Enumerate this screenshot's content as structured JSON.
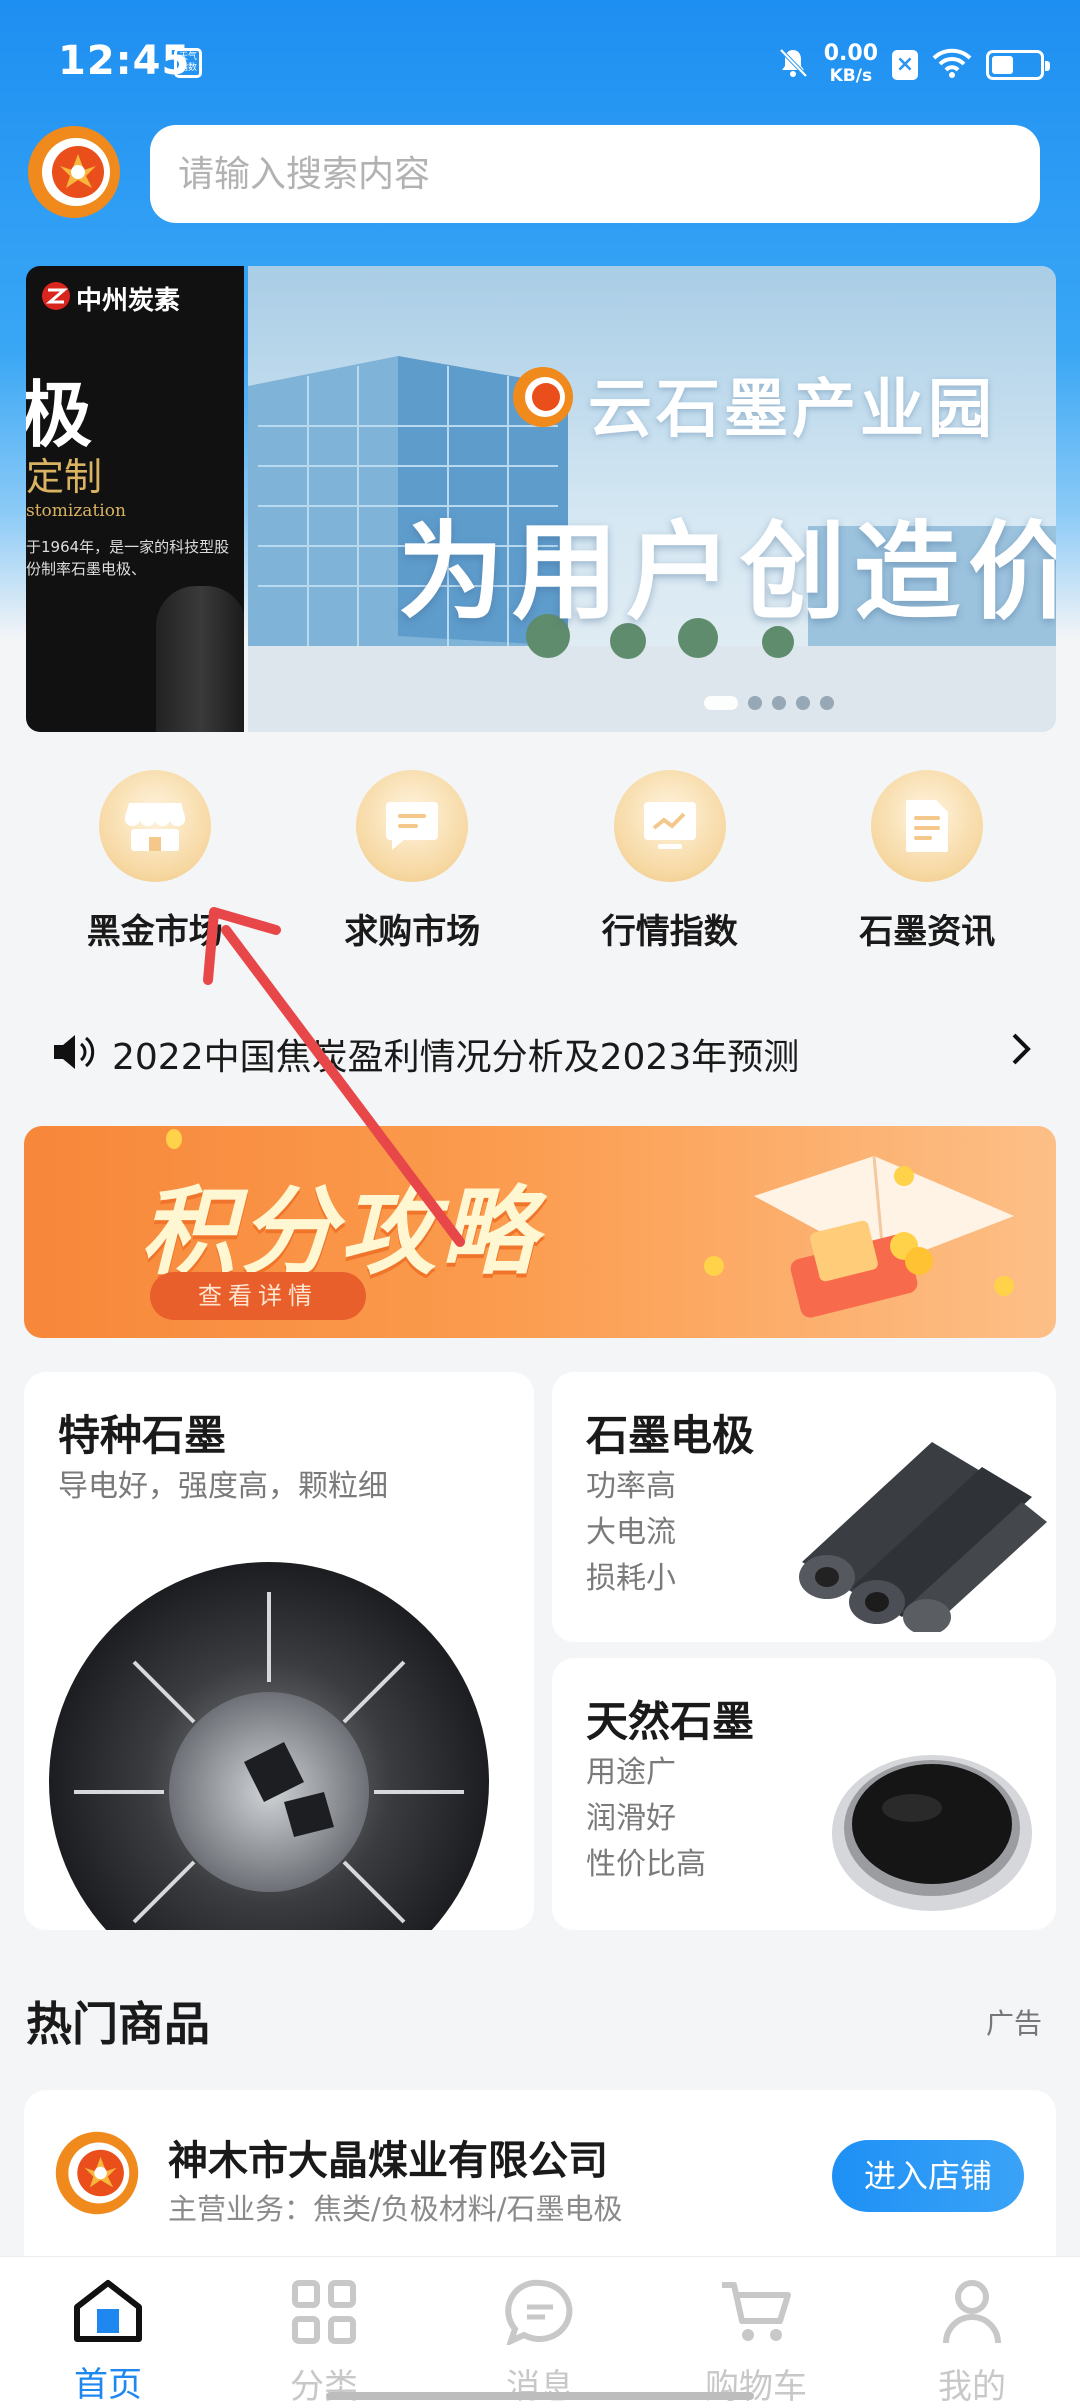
{
  "status_bar": {
    "time": "12:45",
    "weather_badge": "天气 指数",
    "net_speed_value": "0.00",
    "net_speed_unit": "KB/s",
    "battery_level": 0.45,
    "icons": [
      "mute-bell-icon",
      "x-badge-icon",
      "wifi-icon",
      "battery-icon"
    ]
  },
  "header": {
    "logo_icon": "company-logo-icon",
    "search_placeholder": "请输入搜索内容"
  },
  "banner": {
    "left_slide": {
      "brand": "中州炭素",
      "big_text": "极",
      "gold_text": "定制",
      "en_text": "stomization",
      "desc": "于1964年，是一家的科技型股份制率石墨电极、"
    },
    "main_slide": {
      "park_name": "云石墨产业园",
      "slogan": "为用户创造价值"
    },
    "dot_count": 5,
    "active_dot": 0
  },
  "quick_nav": [
    {
      "label": "黑金市场",
      "icon": "store-icon"
    },
    {
      "label": "求购市场",
      "icon": "message-icon"
    },
    {
      "label": "行情指数",
      "icon": "chart-monitor-icon"
    },
    {
      "label": "石墨资讯",
      "icon": "document-icon"
    }
  ],
  "notice": {
    "icon": "speaker-icon",
    "text": "2022中国焦炭盈利情况分析及2023年预测"
  },
  "promo": {
    "title": "积分攻略",
    "button": "查看详情"
  },
  "product_cards": {
    "special": {
      "title": "特种石墨",
      "desc": "导电好，强度高，颗粒细"
    },
    "electrode": {
      "title": "石墨电极",
      "lines": [
        "功率高",
        "大电流",
        "损耗小"
      ]
    },
    "natural": {
      "title": "天然石墨",
      "lines": [
        "用途广",
        "润滑好",
        "性价比高"
      ]
    }
  },
  "hot_products": {
    "title": "热门商品",
    "ad_label": "广告",
    "shop": {
      "name": "神木市大晶煤业有限公司",
      "business": "主营业务：焦类/负极材料/石墨电极",
      "enter_button": "进入店铺"
    }
  },
  "tab_bar": [
    {
      "label": "首页",
      "icon": "home-icon",
      "active": true
    },
    {
      "label": "分类",
      "icon": "grid-icon",
      "active": false
    },
    {
      "label": "消息",
      "icon": "chat-icon",
      "active": false
    },
    {
      "label": "购物车",
      "icon": "cart-icon",
      "active": false
    },
    {
      "label": "我的",
      "icon": "user-icon",
      "active": false
    }
  ],
  "colors": {
    "primary": "#1e88f0",
    "accent_gold": "#f0c27f",
    "promo_orange": "#f7873a",
    "annotation_arrow": "#e8474a"
  }
}
